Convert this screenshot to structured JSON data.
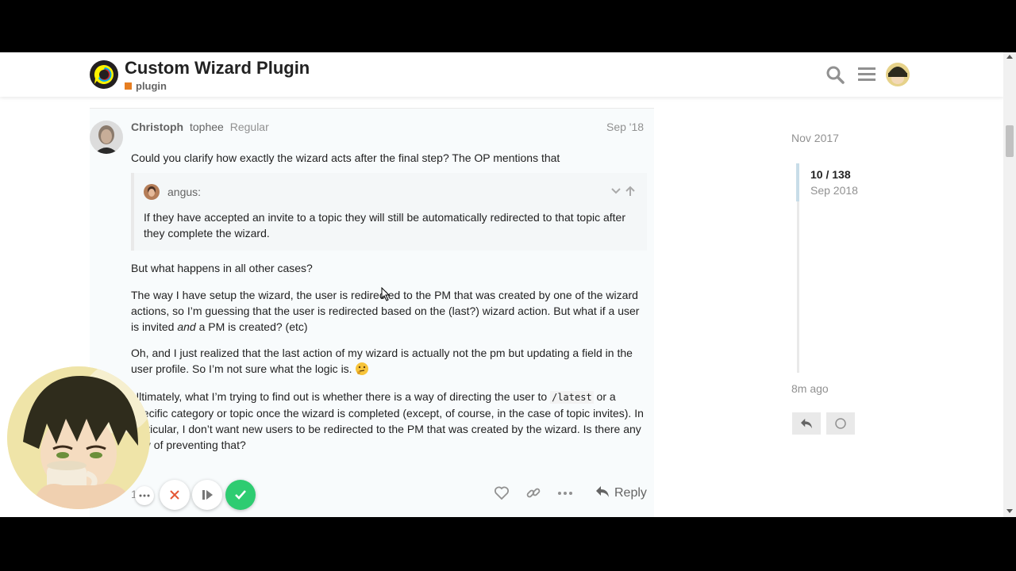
{
  "header": {
    "title": "Custom Wizard Plugin",
    "category": "plugin",
    "category_color": "#e67e22"
  },
  "post": {
    "username": "Christoph",
    "fullname": "tophee",
    "user_title": "Regular",
    "date": "Sep '18",
    "intro": "Could you clarify how exactly the wizard acts after the final step? The OP mentions that",
    "quote": {
      "user": "angus:",
      "text": "If they have accepted an invite to a topic they will still be automatically redirected to that topic after they complete the wizard."
    },
    "p1": "But what happens in all other cases?",
    "p2_a": "The way I have setup the wizard, the user is redirected to the PM that was created by one of the wizard actions, so I’m guessing that the user is redirected based on the (last?) wizard action. But what if a user is invited ",
    "p2_em": "and",
    "p2_b": " a PM is created? (etc)",
    "p3": "Oh, and I just realized that the last action of my wizard is actually not the pm but updating a field in the user profile. So I’m not sure what the logic is.",
    "p4_a": "Ultimately, what I’m trying to find out is whether there is a way of directing the user to ",
    "p4_code": "/latest",
    "p4_b": " or a specific category or topic once the wizard is completed (except, of course, in the case of topic invites). In particular, I don’t want new users to be redirected to the PM that was created by the wizard. Is there any way of preventing that?",
    "reply_label": "Reply",
    "footer_partial": "1 p"
  },
  "timeline": {
    "start_date": "Nov 2017",
    "position": "10 / 138",
    "position_date": "Sep 2018",
    "end_date": "8m ago"
  },
  "icons": {
    "search": "search-icon",
    "menu": "hamburger-icon",
    "like": "heart-icon",
    "link": "link-icon",
    "more": "ellipsis-icon",
    "reply": "reply-icon",
    "thinking": "thinking-emoji"
  },
  "colors": {
    "accent_green": "#2ecc71",
    "close_red": "#e45735"
  }
}
